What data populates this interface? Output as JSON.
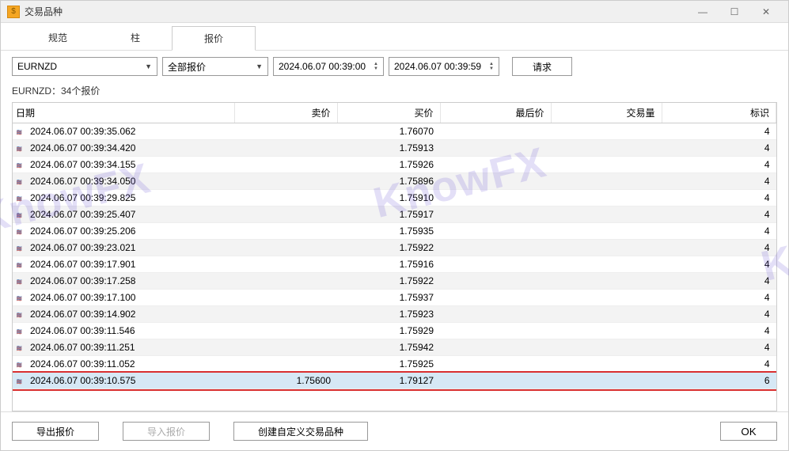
{
  "window": {
    "title": "交易品种"
  },
  "tabs": [
    {
      "label": "规范",
      "active": false
    },
    {
      "label": "柱",
      "active": false
    },
    {
      "label": "报价",
      "active": true
    }
  ],
  "filters": {
    "symbol": "EURNZD",
    "quote_type": "全部报价",
    "from_datetime": "2024.06.07 00:39:00",
    "to_datetime": "2024.06.07 00:39:59",
    "request_label": "请求"
  },
  "summary": "EURNZD：34个报价",
  "columns": {
    "date": "日期",
    "sell": "卖价",
    "buy": "买价",
    "last": "最后价",
    "volume": "交易量",
    "flag": "标识"
  },
  "rows": [
    {
      "date": "2024.06.07 00:39:35.062",
      "sell": "",
      "buy": "1.76070",
      "last": "",
      "vol": "",
      "flag": "4",
      "hl": false
    },
    {
      "date": "2024.06.07 00:39:34.420",
      "sell": "",
      "buy": "1.75913",
      "last": "",
      "vol": "",
      "flag": "4",
      "hl": false
    },
    {
      "date": "2024.06.07 00:39:34.155",
      "sell": "",
      "buy": "1.75926",
      "last": "",
      "vol": "",
      "flag": "4",
      "hl": false
    },
    {
      "date": "2024.06.07 00:39:34.050",
      "sell": "",
      "buy": "1.75896",
      "last": "",
      "vol": "",
      "flag": "4",
      "hl": false
    },
    {
      "date": "2024.06.07 00:39:29.825",
      "sell": "",
      "buy": "1.75910",
      "last": "",
      "vol": "",
      "flag": "4",
      "hl": false
    },
    {
      "date": "2024.06.07 00:39:25.407",
      "sell": "",
      "buy": "1.75917",
      "last": "",
      "vol": "",
      "flag": "4",
      "hl": false
    },
    {
      "date": "2024.06.07 00:39:25.206",
      "sell": "",
      "buy": "1.75935",
      "last": "",
      "vol": "",
      "flag": "4",
      "hl": false
    },
    {
      "date": "2024.06.07 00:39:23.021",
      "sell": "",
      "buy": "1.75922",
      "last": "",
      "vol": "",
      "flag": "4",
      "hl": false
    },
    {
      "date": "2024.06.07 00:39:17.901",
      "sell": "",
      "buy": "1.75916",
      "last": "",
      "vol": "",
      "flag": "4",
      "hl": false
    },
    {
      "date": "2024.06.07 00:39:17.258",
      "sell": "",
      "buy": "1.75922",
      "last": "",
      "vol": "",
      "flag": "4",
      "hl": false
    },
    {
      "date": "2024.06.07 00:39:17.100",
      "sell": "",
      "buy": "1.75937",
      "last": "",
      "vol": "",
      "flag": "4",
      "hl": false
    },
    {
      "date": "2024.06.07 00:39:14.902",
      "sell": "",
      "buy": "1.75923",
      "last": "",
      "vol": "",
      "flag": "4",
      "hl": false
    },
    {
      "date": "2024.06.07 00:39:11.546",
      "sell": "",
      "buy": "1.75929",
      "last": "",
      "vol": "",
      "flag": "4",
      "hl": false
    },
    {
      "date": "2024.06.07 00:39:11.251",
      "sell": "",
      "buy": "1.75942",
      "last": "",
      "vol": "",
      "flag": "4",
      "hl": false
    },
    {
      "date": "2024.06.07 00:39:11.052",
      "sell": "",
      "buy": "1.75925",
      "last": "",
      "vol": "",
      "flag": "4",
      "hl": false
    },
    {
      "date": "2024.06.07 00:39:10.575",
      "sell": "1.75600",
      "buy": "1.79127",
      "last": "",
      "vol": "",
      "flag": "6",
      "hl": true
    }
  ],
  "footer": {
    "export": "导出报价",
    "import": "导入报价",
    "create_custom": "创建自定义交易品种",
    "ok": "OK"
  },
  "watermark": "KnowFX"
}
